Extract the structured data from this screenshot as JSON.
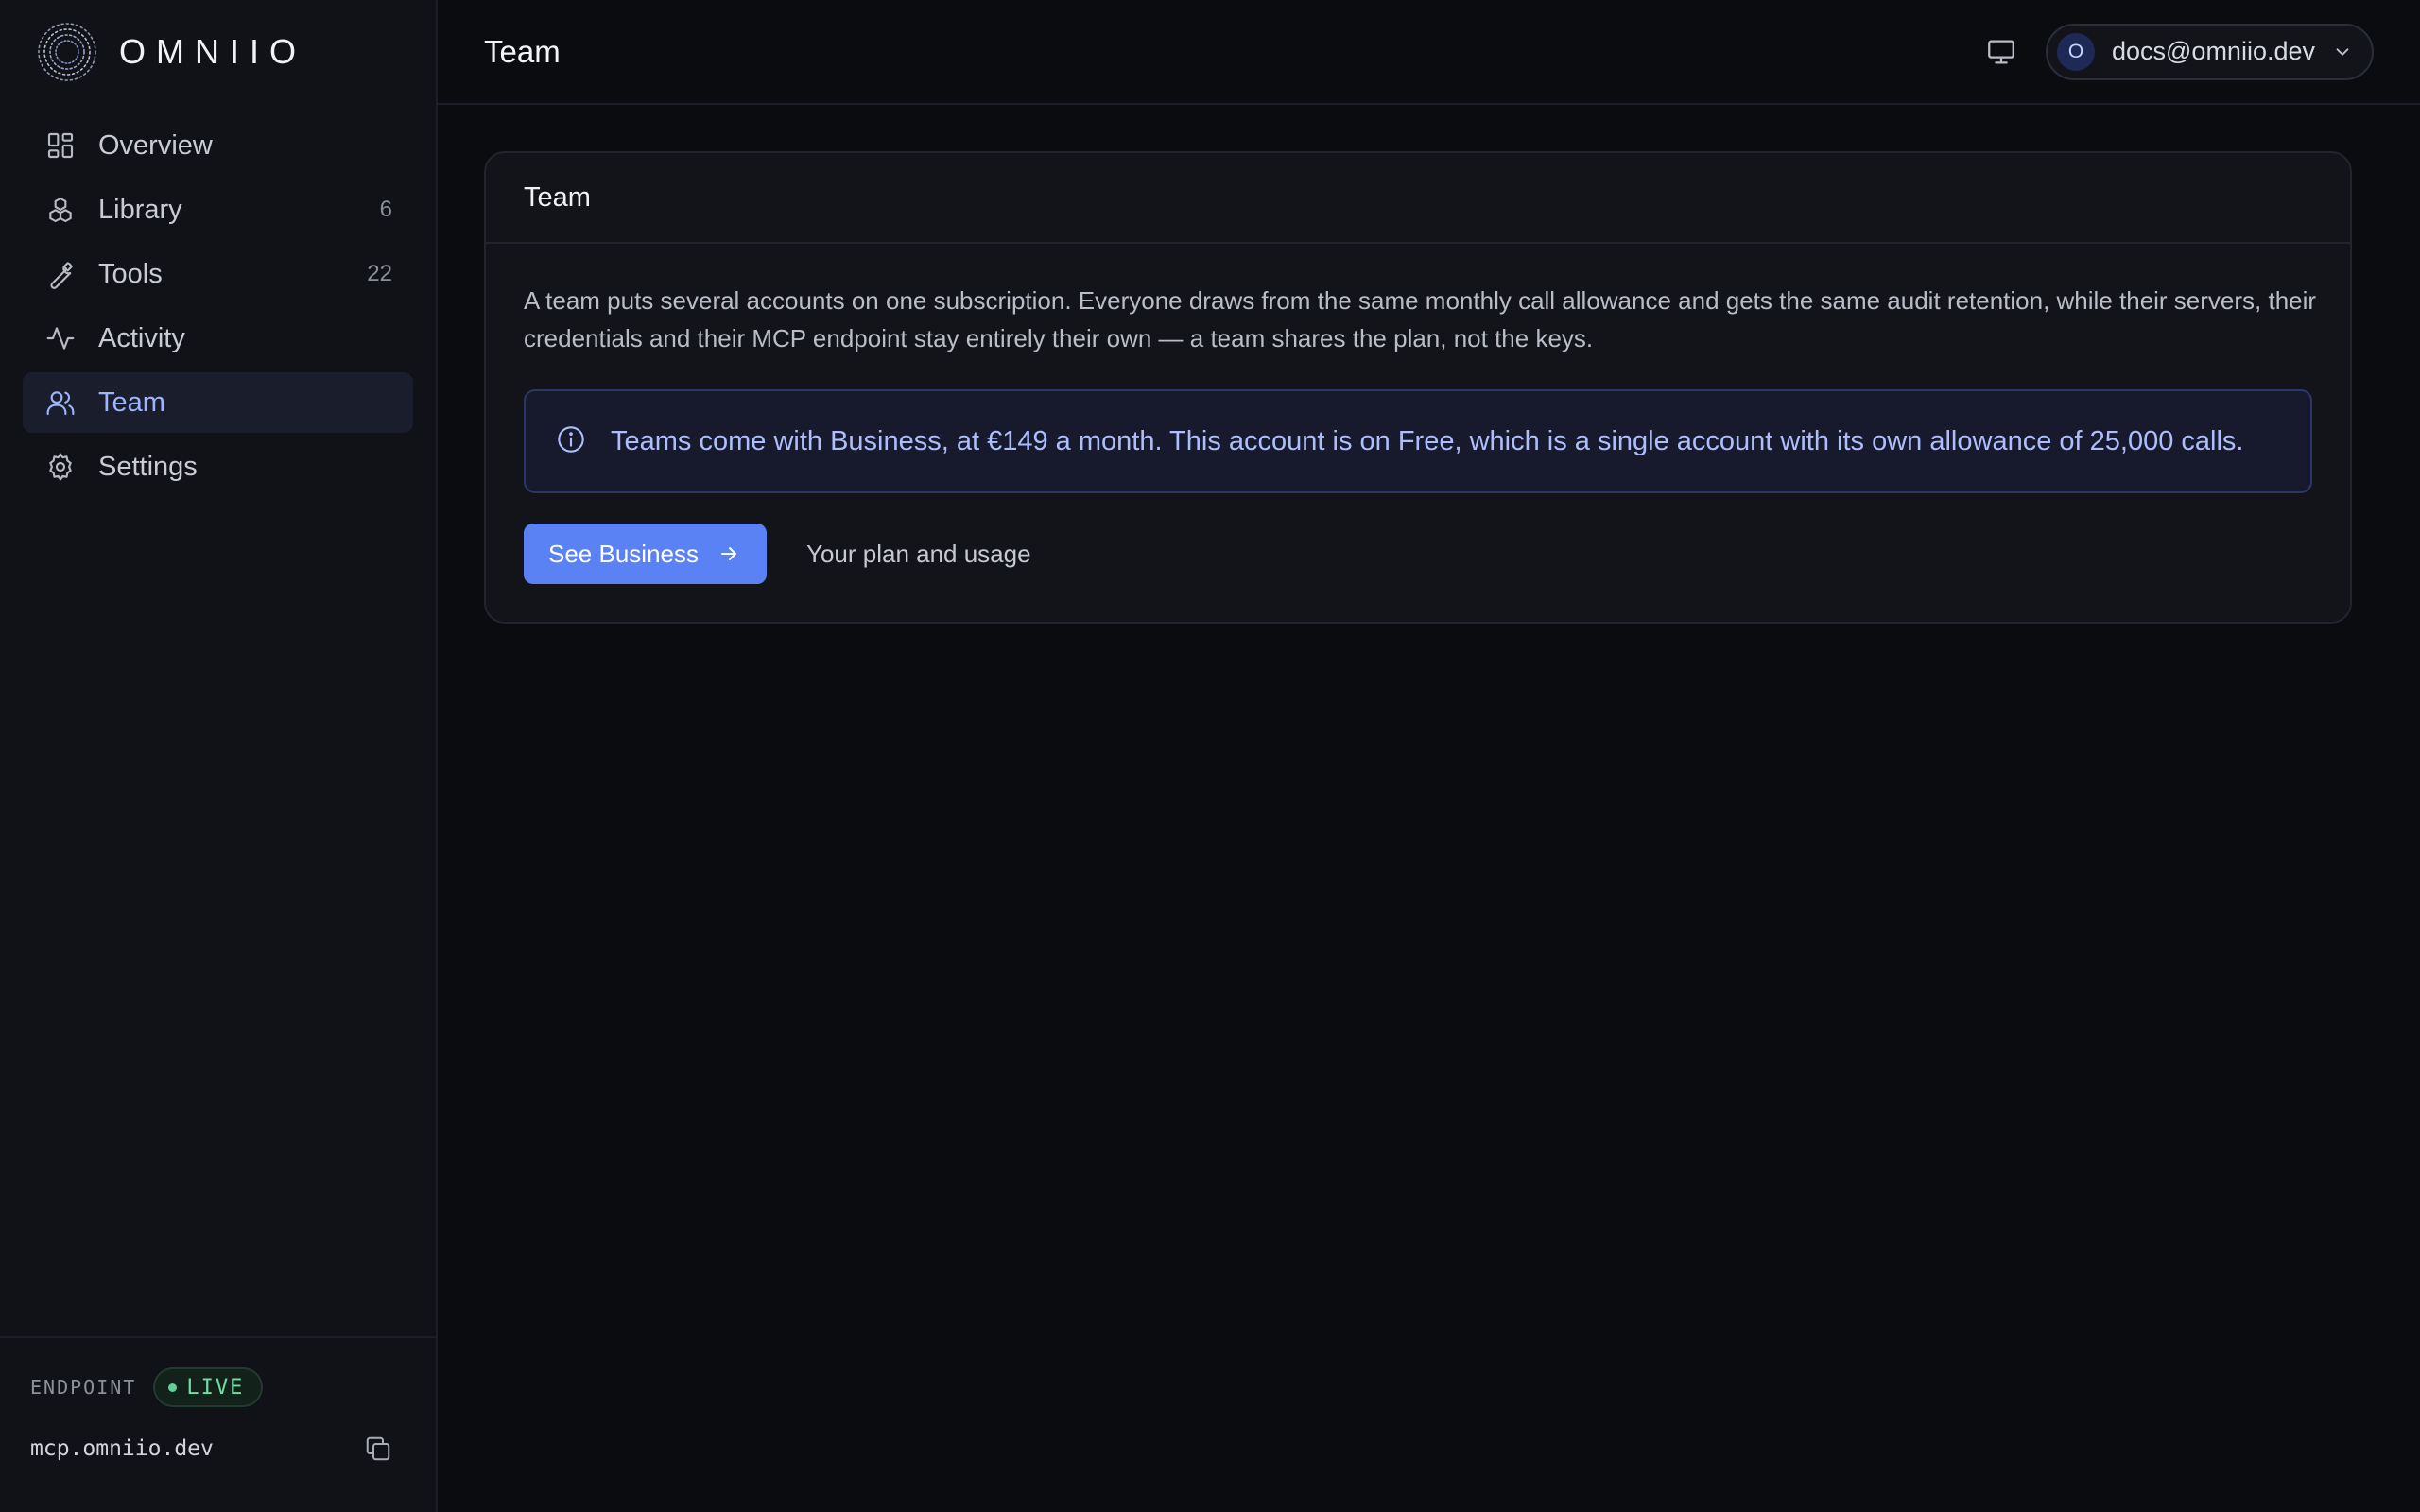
{
  "brand": {
    "name": "OMNIIO"
  },
  "sidebar": {
    "items": [
      {
        "label": "Overview",
        "count": "",
        "icon": "grid-icon"
      },
      {
        "label": "Library",
        "count": "6",
        "icon": "boxes-icon"
      },
      {
        "label": "Tools",
        "count": "22",
        "icon": "wrench-icon"
      },
      {
        "label": "Activity",
        "count": "",
        "icon": "activity-icon"
      },
      {
        "label": "Team",
        "count": "",
        "icon": "users-icon",
        "active": true
      },
      {
        "label": "Settings",
        "count": "",
        "icon": "gear-icon"
      }
    ],
    "footer": {
      "endpoint_label": "ENDPOINT",
      "status": "LIVE",
      "url": "mcp.omniio.dev"
    }
  },
  "header": {
    "title": "Team",
    "user": {
      "initial": "O",
      "email": "docs@omniio.dev"
    }
  },
  "card": {
    "title": "Team",
    "description": "A team puts several accounts on one subscription. Everyone draws from the same monthly call allowance and gets the same audit retention, while their servers, their credentials and their MCP endpoint stay entirely their own — a team shares the plan, not the keys.",
    "notice": "Teams come with Business, at €149 a month. This account is on Free, which is a single account with its own allowance of 25,000 calls.",
    "primary_action": "See Business",
    "secondary_action": "Your plan and usage"
  },
  "colors": {
    "accent": "#5b82f5",
    "active_nav": "#9db4ff",
    "live": "#6fe0a4"
  }
}
